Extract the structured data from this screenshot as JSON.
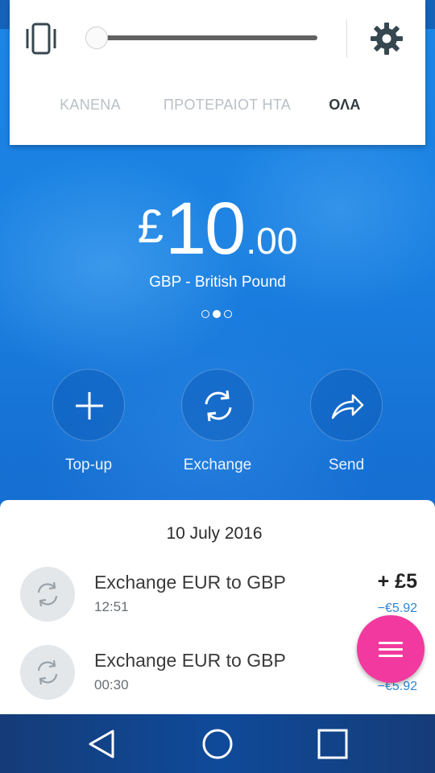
{
  "quick_panel": {
    "tabs": [
      {
        "label": "ΚΑΝΕΝΑ",
        "selected": false
      },
      {
        "label": "ΠΡΟΤΕΡΑΙΟΤ ΗΤΑ",
        "selected": false
      },
      {
        "label": "ΟΛΑ",
        "selected": true
      }
    ],
    "volume_level": 0.0,
    "icons": {
      "left": "vibrate-icon",
      "right": "gear-icon"
    }
  },
  "balance": {
    "symbol": "£",
    "whole": "10",
    "decimal": ".00",
    "currency_name": "GBP - British Pound",
    "page_indicator": {
      "count": 3,
      "active": 1
    }
  },
  "actions": [
    {
      "label": "Top-up",
      "icon": "plus-icon"
    },
    {
      "label": "Exchange",
      "icon": "exchange-icon"
    },
    {
      "label": "Send",
      "icon": "send-arrow-icon"
    }
  ],
  "transactions": {
    "date": "10 July 2016",
    "items": [
      {
        "title": "Exchange EUR to GBP",
        "time": "12:51",
        "amount": "+ £5",
        "sub_amount": "−€5.92",
        "icon": "exchange-icon"
      },
      {
        "title": "Exchange EUR to GBP",
        "time": "00:30",
        "amount": "",
        "sub_amount": "−€5.92",
        "icon": "exchange-icon"
      }
    ]
  },
  "fab": {
    "icon": "menu-icon",
    "color": "#f1399f"
  },
  "nav": {
    "icons": [
      "back-icon",
      "home-icon",
      "recents-icon"
    ]
  },
  "colors": {
    "accent_blue": "#1a7fe0",
    "amount_link": "#2c86d3"
  }
}
